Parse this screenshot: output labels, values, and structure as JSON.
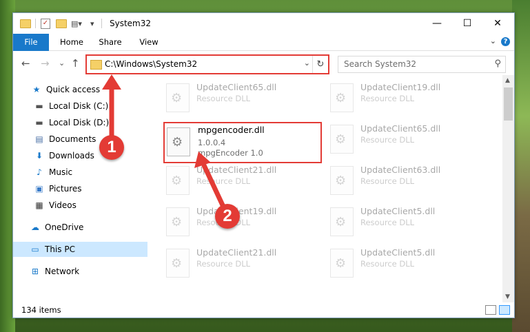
{
  "window": {
    "title": "System32",
    "minimize_glyph": "—",
    "maximize_glyph": "☐",
    "close_glyph": "✕"
  },
  "ribbon": {
    "tabs": [
      "File",
      "Home",
      "Share",
      "View"
    ],
    "help_glyph": "?",
    "expand_glyph": "⌄"
  },
  "nav": {
    "back_glyph": "←",
    "forward_glyph": "→",
    "recent_glyph": "⌄",
    "up_glyph": "↑",
    "address": "C:\\Windows\\System32",
    "refresh_glyph": "↻",
    "search_placeholder": "Search System32"
  },
  "sidebar": {
    "items": [
      {
        "label": "Quick access",
        "icon": "star-icon"
      },
      {
        "label": "Local Disk (C:)",
        "icon": "drive-icon"
      },
      {
        "label": "Local Disk (D:)",
        "icon": "drive-icon"
      },
      {
        "label": "Documents",
        "icon": "documents-icon"
      },
      {
        "label": "Downloads",
        "icon": "download-icon"
      },
      {
        "label": "Music",
        "icon": "music-icon"
      },
      {
        "label": "Pictures",
        "icon": "pictures-icon"
      },
      {
        "label": "Videos",
        "icon": "videos-icon"
      },
      {
        "label": "OneDrive",
        "icon": "cloud-icon"
      },
      {
        "label": "This PC",
        "icon": "computer-icon"
      },
      {
        "label": "Network",
        "icon": "network-icon"
      }
    ]
  },
  "files": {
    "left_col": [
      {
        "name": "UpdateClient65.dll",
        "type": "Resource DLL"
      },
      {
        "name": "UpdateClient21.dll",
        "type": "Resource DLL"
      },
      {
        "name": "UpdateClient19.dll",
        "type": "Resource DLL"
      },
      {
        "name": "UpdateClient21.dll",
        "type": "Resource DLL"
      }
    ],
    "right_col": [
      {
        "name": "UpdateClient19.dll",
        "type": "Resource DLL"
      },
      {
        "name": "UpdateClient65.dll",
        "type": "Resource DLL"
      },
      {
        "name": "UpdateClient63.dll",
        "type": "Resource DLL"
      },
      {
        "name": "UpdateClient5.dll",
        "type": "Resource DLL"
      },
      {
        "name": "UpdateClient5.dll",
        "type": "Resource DLL"
      }
    ],
    "highlighted": {
      "name": "mpgencoder.dll",
      "version": "1.0.0.4",
      "description": "mpgEncoder 1.0"
    }
  },
  "status": {
    "item_count": "134 items"
  },
  "annotations": {
    "step1": "1",
    "step2": "2",
    "color": "#e33b35"
  }
}
